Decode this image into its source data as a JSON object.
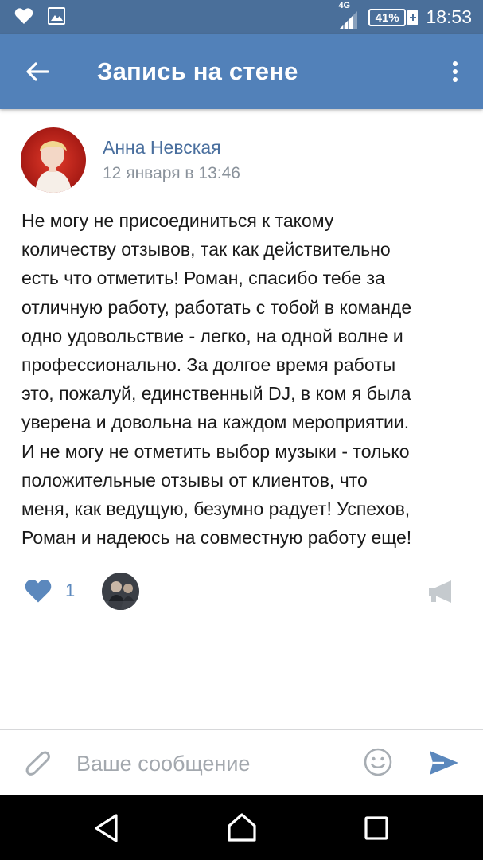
{
  "status_bar": {
    "network_label": "4G",
    "battery_percent": "41%",
    "battery_level": 0.41,
    "time": "18:53",
    "icons": [
      "heart-icon",
      "image-icon",
      "signal-icon",
      "battery-charging-icon"
    ]
  },
  "app_bar": {
    "title": "Запись на стене",
    "back_icon": "arrow-left-icon",
    "menu_icon": "more-vertical-icon"
  },
  "post": {
    "author": "Анна Невская",
    "date": "12 января в 13:46",
    "text": "Не могу не присоединиться к такому\nколичеству отзывов, так как действительно\nесть что отметить! Роман, спасибо тебе за\nотличную работу, работать с тобой в команде\nодно удовольствие - легко, на одной волне и\nпрофессионально. За долгое время работы\nэто, пожалуй, единственный DJ, в ком я была\nуверена и довольна на каждом мероприятии.\nИ не могу не отметить выбор музыки - только\nположительные отзывы от клиентов, что\nменя, как ведущую, безумно радует! Успехов,\nРоман и надеюсь на совместную работу еще!",
    "likes": "1"
  },
  "composer": {
    "placeholder": "Ваше сообщение"
  },
  "colors": {
    "status_bar": "#4a6f9a",
    "app_bar": "#5281b9",
    "link": "#4a6f9e",
    "accent": "#5b88bd",
    "text": "#1a1a1a",
    "muted": "#8a929b"
  }
}
